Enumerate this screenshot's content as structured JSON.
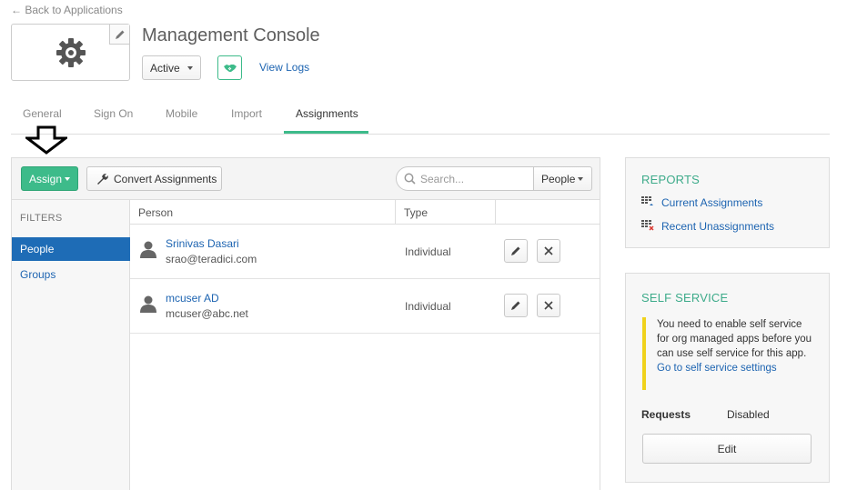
{
  "nav": {
    "back_label": "← Back to Applications"
  },
  "app": {
    "title": "Management Console",
    "status": "Active",
    "view_logs": "View Logs"
  },
  "tabs": [
    {
      "label": "General"
    },
    {
      "label": "Sign On"
    },
    {
      "label": "Mobile"
    },
    {
      "label": "Import"
    },
    {
      "label": "Assignments",
      "active": true
    }
  ],
  "toolbar": {
    "assign_label": "Assign",
    "convert_label": "Convert Assignments",
    "search_placeholder": "Search...",
    "filter_select": "People"
  },
  "filters": {
    "heading": "FILTERS",
    "items": [
      {
        "label": "People",
        "active": true
      },
      {
        "label": "Groups"
      }
    ]
  },
  "table": {
    "columns": [
      "Person",
      "Type"
    ],
    "rows": [
      {
        "name": "Srinivas Dasari",
        "email": "srao@teradici.com",
        "type": "Individual"
      },
      {
        "name": "mcuser AD",
        "email": "mcuser@abc.net",
        "type": "Individual"
      }
    ]
  },
  "reports": {
    "title": "REPORTS",
    "links": [
      "Current Assignments",
      "Recent Unassignments"
    ]
  },
  "self_service": {
    "title": "SELF SERVICE",
    "notice": "You need to enable self service for org managed apps before you can use self service for this app.",
    "settings_link": "Go to self service settings",
    "requests_label": "Requests",
    "requests_value": "Disabled",
    "edit_label": "Edit"
  },
  "colors": {
    "accent_green": "#3dbb8a",
    "link_blue": "#1d64b1",
    "active_filter_blue": "#1e6cb6",
    "notice_yellow": "#f0d21c"
  }
}
